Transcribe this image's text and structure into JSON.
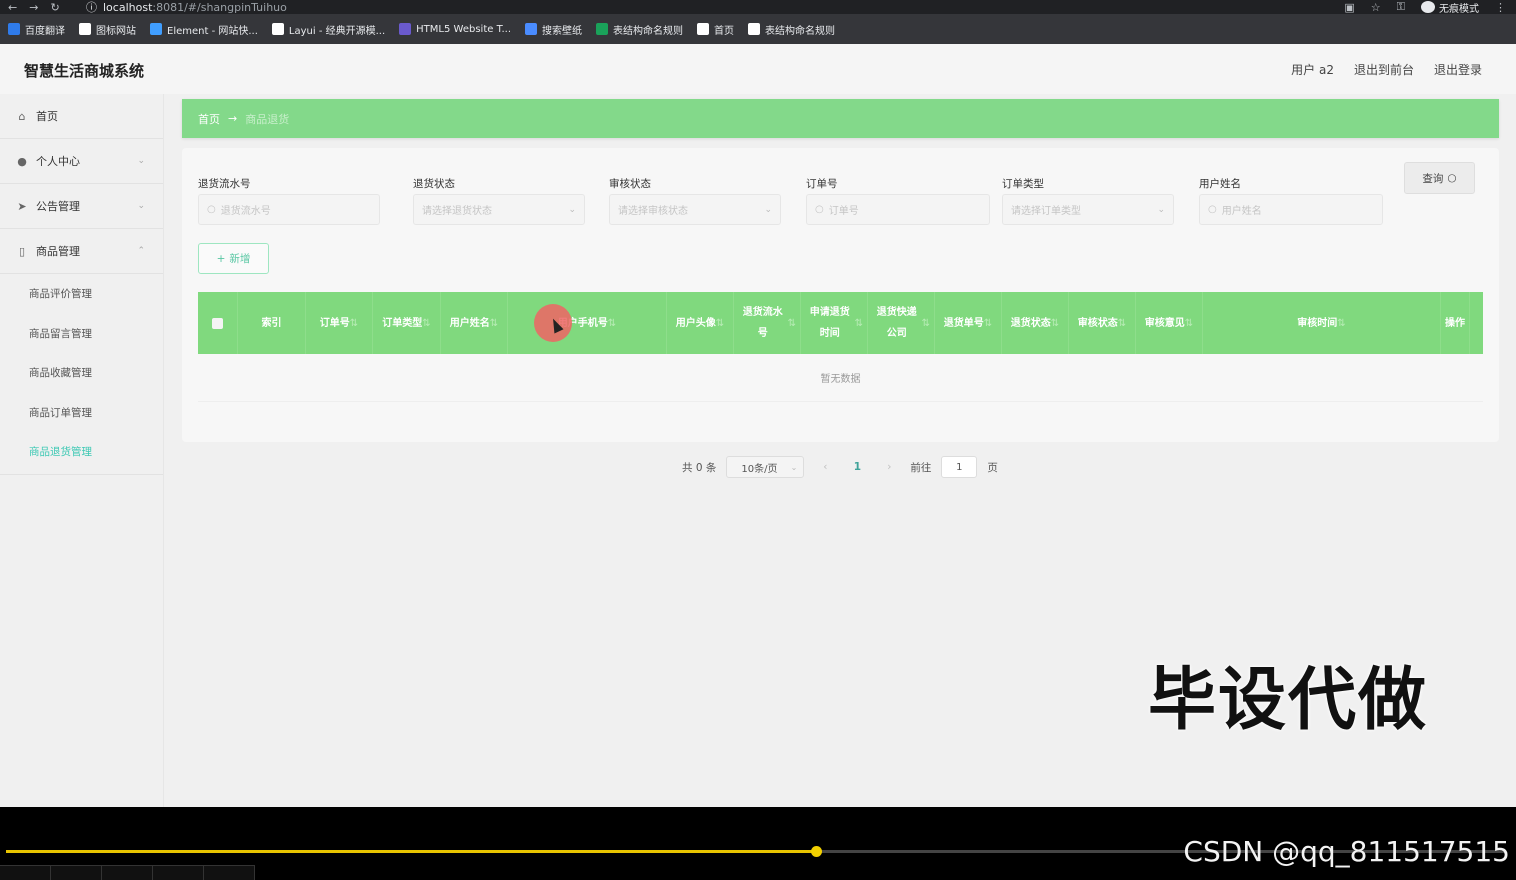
{
  "browser": {
    "url_host": "localhost",
    "url_path": ":8081/#/shangpinTuihuo",
    "incognito_label": "无痕模式",
    "bookmarks": [
      {
        "label": "百度翻译",
        "color": "#2f7bea"
      },
      {
        "label": "图标网站",
        "color": "#ffffff"
      },
      {
        "label": "Element - 网站快...",
        "color": "#409eff"
      },
      {
        "label": "Layui - 经典开源模...",
        "color": "#ffffff"
      },
      {
        "label": "HTML5 Website T...",
        "color": "#6a5acd"
      },
      {
        "label": "搜索壁纸",
        "color": "#4a8cff"
      },
      {
        "label": "表结构命名规则",
        "color": "#1aa25a"
      },
      {
        "label": "首页",
        "color": "#ffffff"
      },
      {
        "label": "表结构命名规则",
        "color": "#ffffff"
      }
    ]
  },
  "header": {
    "title": "智慧生活商城系统",
    "user": "用户 a2",
    "to_front": "退出到前台",
    "logout": "退出登录"
  },
  "sidebar": {
    "items": [
      {
        "label": "首页",
        "icon": "home-icon"
      },
      {
        "label": "个人中心",
        "icon": "user-icon"
      },
      {
        "label": "公告管理",
        "icon": "send-icon"
      },
      {
        "label": "商品管理",
        "icon": "phone-icon"
      }
    ],
    "sub_items": [
      "商品评价管理",
      "商品留言管理",
      "商品收藏管理",
      "商品订单管理",
      "商品退货管理"
    ]
  },
  "breadcrumb": {
    "home": "首页",
    "arrow": "→",
    "current": "商品退货"
  },
  "search": {
    "fields": [
      {
        "label": "退货流水号",
        "placeholder": "退货流水号",
        "type": "input"
      },
      {
        "label": "退货状态",
        "placeholder": "请选择退货状态",
        "type": "select"
      },
      {
        "label": "审核状态",
        "placeholder": "请选择审核状态",
        "type": "select"
      },
      {
        "label": "订单号",
        "placeholder": "订单号",
        "type": "input"
      },
      {
        "label": "订单类型",
        "placeholder": "请选择订单类型",
        "type": "select"
      },
      {
        "label": "用户姓名",
        "placeholder": "用户姓名",
        "type": "input"
      }
    ],
    "query_label": "查询",
    "add_label": "新增"
  },
  "table": {
    "columns": [
      "索引",
      "订单号",
      "订单类型",
      "用户姓名",
      "用户手机号",
      "用户头像",
      "退货流水号",
      "申请退货时间",
      "退货快递公司",
      "退货单号",
      "退货状态",
      "审核状态",
      "审核意见",
      "审核时间",
      "操作"
    ],
    "empty_text": "暂无数据"
  },
  "pagination": {
    "total": "共 0 条",
    "page_size": "10条/页",
    "current_page": "1",
    "goto_label": "前往",
    "goto_value": "1",
    "page_suffix": "页"
  },
  "overlay": {
    "watermark": "毕设代做",
    "csdn": "CSDN @qq_811517515"
  },
  "player": {
    "progress": 0.54
  }
}
